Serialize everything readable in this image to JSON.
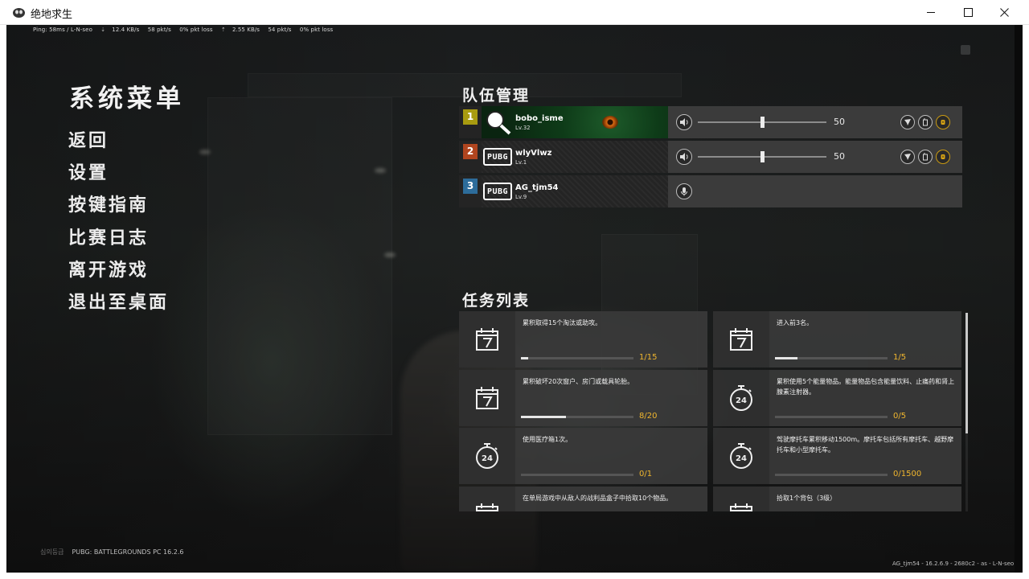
{
  "window": {
    "title": "绝地求生",
    "controls": {
      "minimize": "minimize-icon",
      "maximize": "maximize-icon",
      "close": "close-icon"
    }
  },
  "netstat": {
    "ping": "Ping: 58ms  / L-N-seo",
    "down_rate": "12.4 KB/s",
    "down_pkt": "58 pkt/s",
    "down_loss": "0% pkt loss",
    "up_rate": "2.55 KB/s",
    "up_pkt": "54 pkt/s",
    "up_loss": "0% pkt loss"
  },
  "system_menu": {
    "title": "系统菜单",
    "items": [
      "返回",
      "设置",
      "按键指南",
      "比赛日志",
      "离开游戏",
      "退出至桌面"
    ]
  },
  "team": {
    "title": "队伍管理",
    "members": [
      {
        "slot": "1",
        "slot_color": "#a89b10",
        "name": "bobo_isme",
        "level": "Lv.32",
        "volume": "50",
        "volume_fraction": 0.5,
        "has_controls": true
      },
      {
        "slot": "2",
        "slot_color": "#b0451f",
        "name": "wlyVlwz",
        "level": "Lv.1",
        "volume": "50",
        "volume_fraction": 0.5,
        "has_controls": true
      },
      {
        "slot": "3",
        "slot_color": "#2d6c9a",
        "name": "AG_tjm54",
        "level": "Lv.9",
        "has_controls": false
      }
    ],
    "logo_text": "PUBG"
  },
  "missions": {
    "title": "任务列表",
    "items": [
      {
        "icon": "calendar-7-icon",
        "text": "累积取得15个淘汰或助攻。",
        "progress": "1/15",
        "fraction": 0.0667
      },
      {
        "icon": "calendar-7-icon",
        "text": "进入前3名。",
        "progress": "1/5",
        "fraction": 0.2
      },
      {
        "icon": "calendar-7-icon",
        "text": "累积破坏20次窗户、房门或载具轮胎。",
        "progress": "8/20",
        "fraction": 0.4
      },
      {
        "icon": "stopwatch-24-icon",
        "text": "累积使用5个能量物品。能量物品包含能量饮料、止痛药和肾上腺素注射器。",
        "progress": "0/5",
        "fraction": 0
      },
      {
        "icon": "stopwatch-24-icon",
        "text": "使用医疗箱1次。",
        "progress": "0/1",
        "fraction": 0
      },
      {
        "icon": "stopwatch-24-icon",
        "text": "驾驶摩托车累积移动1500m。摩托车包括所有摩托车、越野摩托车和小型摩托车。",
        "progress": "0/1500",
        "fraction": 0
      },
      {
        "icon": "calendar-7-icon",
        "text": "在单局游戏中从敌人的战利品盒子中拾取10个物品。",
        "progress": "",
        "fraction": 0
      },
      {
        "icon": "calendar-7-icon",
        "text": "拾取1个背包（3级）",
        "progress": "",
        "fraction": 0
      }
    ]
  },
  "footer": {
    "rating": "심의등급",
    "version": "PUBG: BATTLEGROUNDS PC 16.2.6",
    "build": "AG_tjm54 - 16.2.6.9 - 2680c2 - as - L-N-seo"
  },
  "colors": {
    "accent_gold": "#f0b62e",
    "panel": "#404040"
  }
}
